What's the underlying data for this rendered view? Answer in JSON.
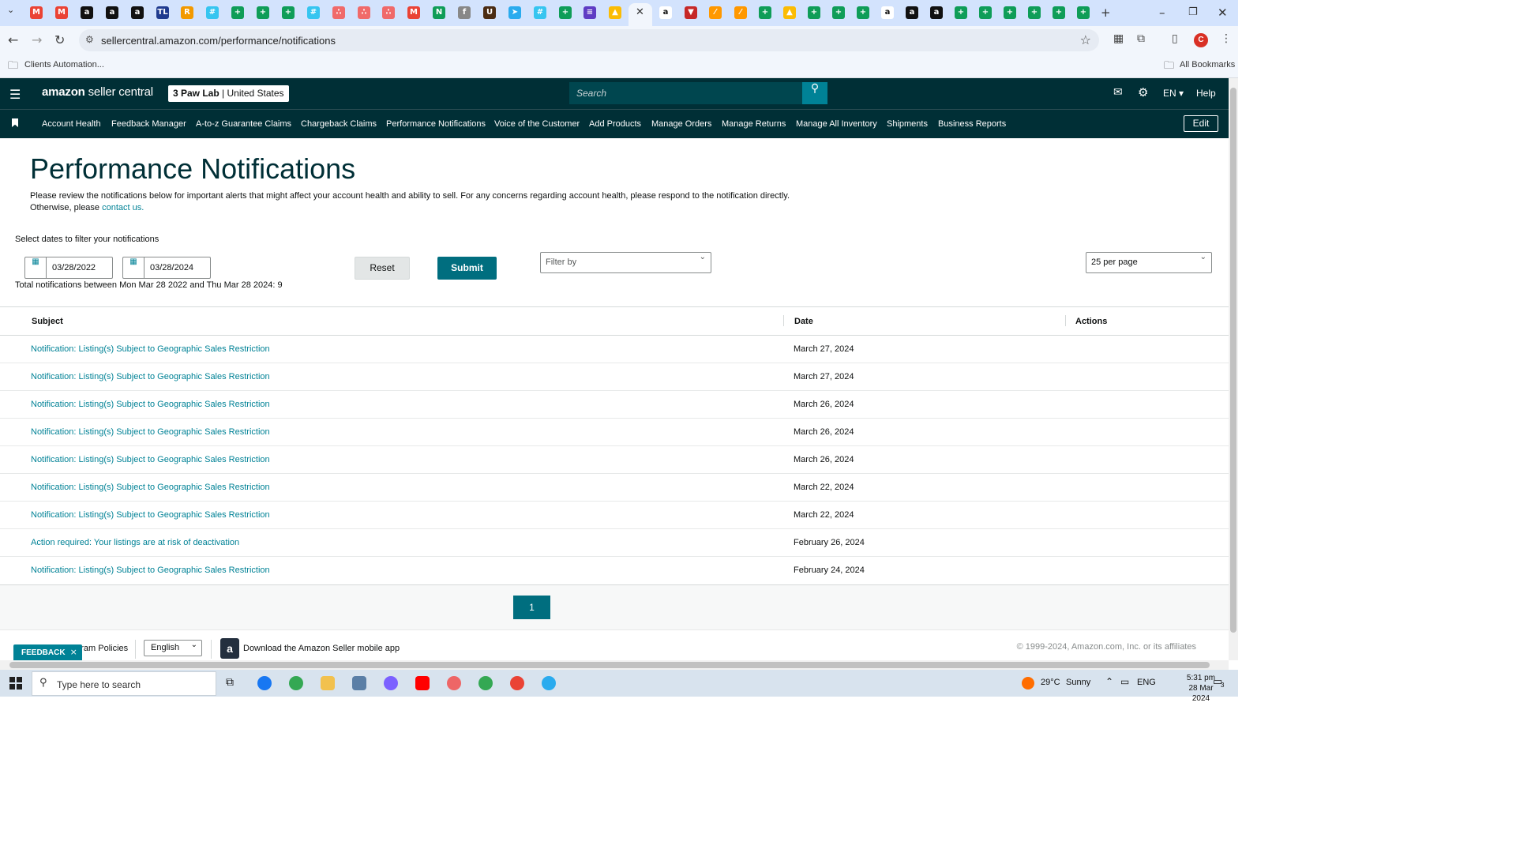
{
  "browser": {
    "url": "sellercentral.amazon.com/performance/notifications",
    "bookmarks": {
      "folder": "Clients Automation...",
      "all": "All Bookmarks"
    },
    "profile_initial": "C"
  },
  "header": {
    "logo_brand": "amazon",
    "logo_product": "seller central",
    "account_name": "3 Paw Lab",
    "account_region": "United States",
    "search_placeholder": "Search",
    "language": "EN",
    "help": "Help"
  },
  "nav": {
    "items": [
      "Account Health",
      "Feedback Manager",
      "A-to-z Guarantee Claims",
      "Chargeback Claims",
      "Performance Notifications",
      "Voice of the Customer",
      "Add Products",
      "Manage Orders",
      "Manage Returns",
      "Manage All Inventory",
      "Shipments",
      "Business Reports"
    ],
    "edit": "Edit"
  },
  "main": {
    "title": "Performance Notifications",
    "intro": "Please review the notifications below for important alerts that might affect your account health and ability to sell. For any concerns regarding account health, please respond to the notification directly. Otherwise, please",
    "intro_link": "contact us.",
    "filter_label": "Select dates to filter your notifications",
    "date_from": "03/28/2022",
    "date_to": "03/28/2024",
    "reset": "Reset",
    "submit": "Submit",
    "filter_by": "Filter by",
    "per_page": "25 per page",
    "total": "Total notifications between Mon Mar 28 2022 and Thu Mar 28 2024: 9"
  },
  "table": {
    "headers": {
      "subject": "Subject",
      "date": "Date",
      "actions": "Actions"
    },
    "rows": [
      {
        "subject": "Notification: Listing(s) Subject to Geographic Sales Restriction",
        "date": "March 27, 2024"
      },
      {
        "subject": "Notification: Listing(s) Subject to Geographic Sales Restriction",
        "date": "March 27, 2024"
      },
      {
        "subject": "Notification: Listing(s) Subject to Geographic Sales Restriction",
        "date": "March 26, 2024"
      },
      {
        "subject": "Notification: Listing(s) Subject to Geographic Sales Restriction",
        "date": "March 26, 2024"
      },
      {
        "subject": "Notification: Listing(s) Subject to Geographic Sales Restriction",
        "date": "March 26, 2024"
      },
      {
        "subject": "Notification: Listing(s) Subject to Geographic Sales Restriction",
        "date": "March 22, 2024"
      },
      {
        "subject": "Notification: Listing(s) Subject to Geographic Sales Restriction",
        "date": "March 22, 2024"
      },
      {
        "subject": "Action required: Your listings are at risk of deactivation",
        "date": "February 26, 2024"
      },
      {
        "subject": "Notification: Listing(s) Subject to Geographic Sales Restriction",
        "date": "February 24, 2024"
      }
    ]
  },
  "pagination": {
    "current": "1"
  },
  "footer": {
    "policies": "ogram Policies",
    "language": "English",
    "app_text": "Download the Amazon Seller mobile app",
    "copyright": "© 1999-2024, Amazon.com, Inc. or its affiliates",
    "feedback": "FEEDBACK"
  },
  "taskbar": {
    "search_placeholder": "Type here to search",
    "weather_temp": "29°C",
    "weather_text": "Sunny",
    "lang": "ENG",
    "time": "5:31 pm",
    "date": "28 Mar 2024",
    "notifications": "3"
  },
  "colors": {
    "header_bg": "#002f36",
    "accent": "#008296",
    "button": "#006e7f"
  }
}
